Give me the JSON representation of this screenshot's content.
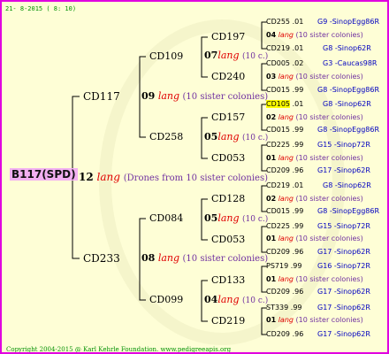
{
  "header": {
    "date": "21- 8-2015 ( 8: 10)"
  },
  "footer": {
    "copyright": "Copyright 2004-2015 @ Karl Kehrle Foundation.   www.pedigreeapis.org"
  },
  "root": {
    "id": "B117(SPD)",
    "year": "12",
    "lang": "lang",
    "note": "(Drones from 10 sister colonies)"
  },
  "gen1": [
    {
      "id": "CD117",
      "year": "09",
      "lang": "lang",
      "note": "(10 sister colonies)"
    },
    {
      "id": "CD233",
      "year": "08",
      "lang": "lang",
      "note": "(10 sister colonies)"
    }
  ],
  "gen2": [
    {
      "id": "CD109",
      "year": "07",
      "lang": "lang",
      "note": "(10 c.)"
    },
    {
      "id": "CD258",
      "year": "05",
      "lang": "lang",
      "note": "(10 c.)"
    },
    {
      "id": "CD084",
      "year": "05",
      "lang": "lang",
      "note": "(10 c.)"
    },
    {
      "id": "CD099",
      "year": "04",
      "lang": "lang",
      "note": "(10 c.)"
    }
  ],
  "gen3": [
    {
      "id": "CD197",
      "year": "04",
      "lang": "lang",
      "note": "(10 sister colonies)"
    },
    {
      "id": "CD240",
      "year": "03",
      "lang": "lang",
      "note": "(10 sister colonies)"
    },
    {
      "id": "CD157",
      "year": "02",
      "lang": "lang",
      "note": "(10 sister colonies)"
    },
    {
      "id": "CD053",
      "year": "01",
      "lang": "lang",
      "note": "(10 sister colonies)"
    },
    {
      "id": "CD128",
      "year": "02",
      "lang": "lang",
      "note": "(10 sister colonies)"
    },
    {
      "id": "CD053",
      "year": "01",
      "lang": "lang",
      "note": "(10 sister colonies)"
    },
    {
      "id": "CD133",
      "year": "01",
      "lang": "lang",
      "note": "(10 sister colonies)"
    },
    {
      "id": "CD219",
      "year": "01",
      "lang": "lang",
      "note": "(10 sister colonies)"
    }
  ],
  "gen4": [
    {
      "id": "CD255",
      "yr": ".01",
      "src": "G9 -SinopEgg86R"
    },
    {
      "id": "CD219",
      "yr": ".01",
      "src": "G8 -Sinop62R"
    },
    {
      "id": "CD005",
      "yr": ".02",
      "src": "G3 -Caucas98R"
    },
    {
      "id": "CD015",
      "yr": ".99",
      "src": "G8 -SinopEgg86R"
    },
    {
      "id": "CD105",
      "yr": ".01",
      "src": "G8 -Sinop62R"
    },
    {
      "id": "CD015",
      "yr": ".99",
      "src": "G8 -SinopEgg86R"
    },
    {
      "id": "CD225",
      "yr": ".99",
      "src": "G15 -Sinop72R"
    },
    {
      "id": "CD209",
      "yr": ".96",
      "src": "G17 -Sinop62R"
    },
    {
      "id": "CD219",
      "yr": ".01",
      "src": "G8 -Sinop62R"
    },
    {
      "id": "CD015",
      "yr": ".99",
      "src": "G8 -SinopEgg86R"
    },
    {
      "id": "CD225",
      "yr": ".99",
      "src": "G15 -Sinop72R"
    },
    {
      "id": "CD209",
      "yr": ".96",
      "src": "G17 -Sinop62R"
    },
    {
      "id": "PS719",
      "yr": ".99",
      "src": "G16 -Sinop72R"
    },
    {
      "id": "CD209",
      "yr": ".96",
      "src": "G17 -Sinop62R"
    },
    {
      "id": "ST339",
      "yr": ".99",
      "src": "G17 -Sinop62R"
    },
    {
      "id": "CD209",
      "yr": ".96",
      "src": "G17 -Sinop62R"
    }
  ],
  "colors": {
    "border": "#e000e0",
    "background": "#fefed6",
    "root_highlight": "#f2b0f2",
    "lang": "#e00000",
    "note": "#7030a0",
    "source": "#0000c0",
    "highlight": "#ffff00"
  }
}
